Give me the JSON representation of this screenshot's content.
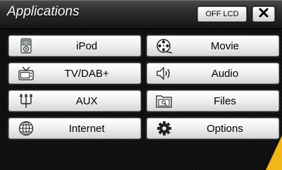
{
  "header": {
    "title": "Applications",
    "off_lcd_label": "OFF LCD",
    "close_label": "✕"
  },
  "apps": {
    "ipod": "iPod",
    "movie": "Movie",
    "tvdab": "TV/DAB+",
    "audio": "Audio",
    "aux": "AUX",
    "files": "Files",
    "internet": "Internet",
    "options": "Options"
  },
  "icons": [
    "ipod-icon",
    "movie-reel-icon",
    "tv-icon",
    "speaker-icon",
    "aux-connector-icon",
    "folder-icon",
    "globe-icon",
    "gear-icon",
    "close-icon"
  ],
  "colors": {
    "accent_arrow": "#f2b619",
    "background": "#0e0e0e"
  }
}
